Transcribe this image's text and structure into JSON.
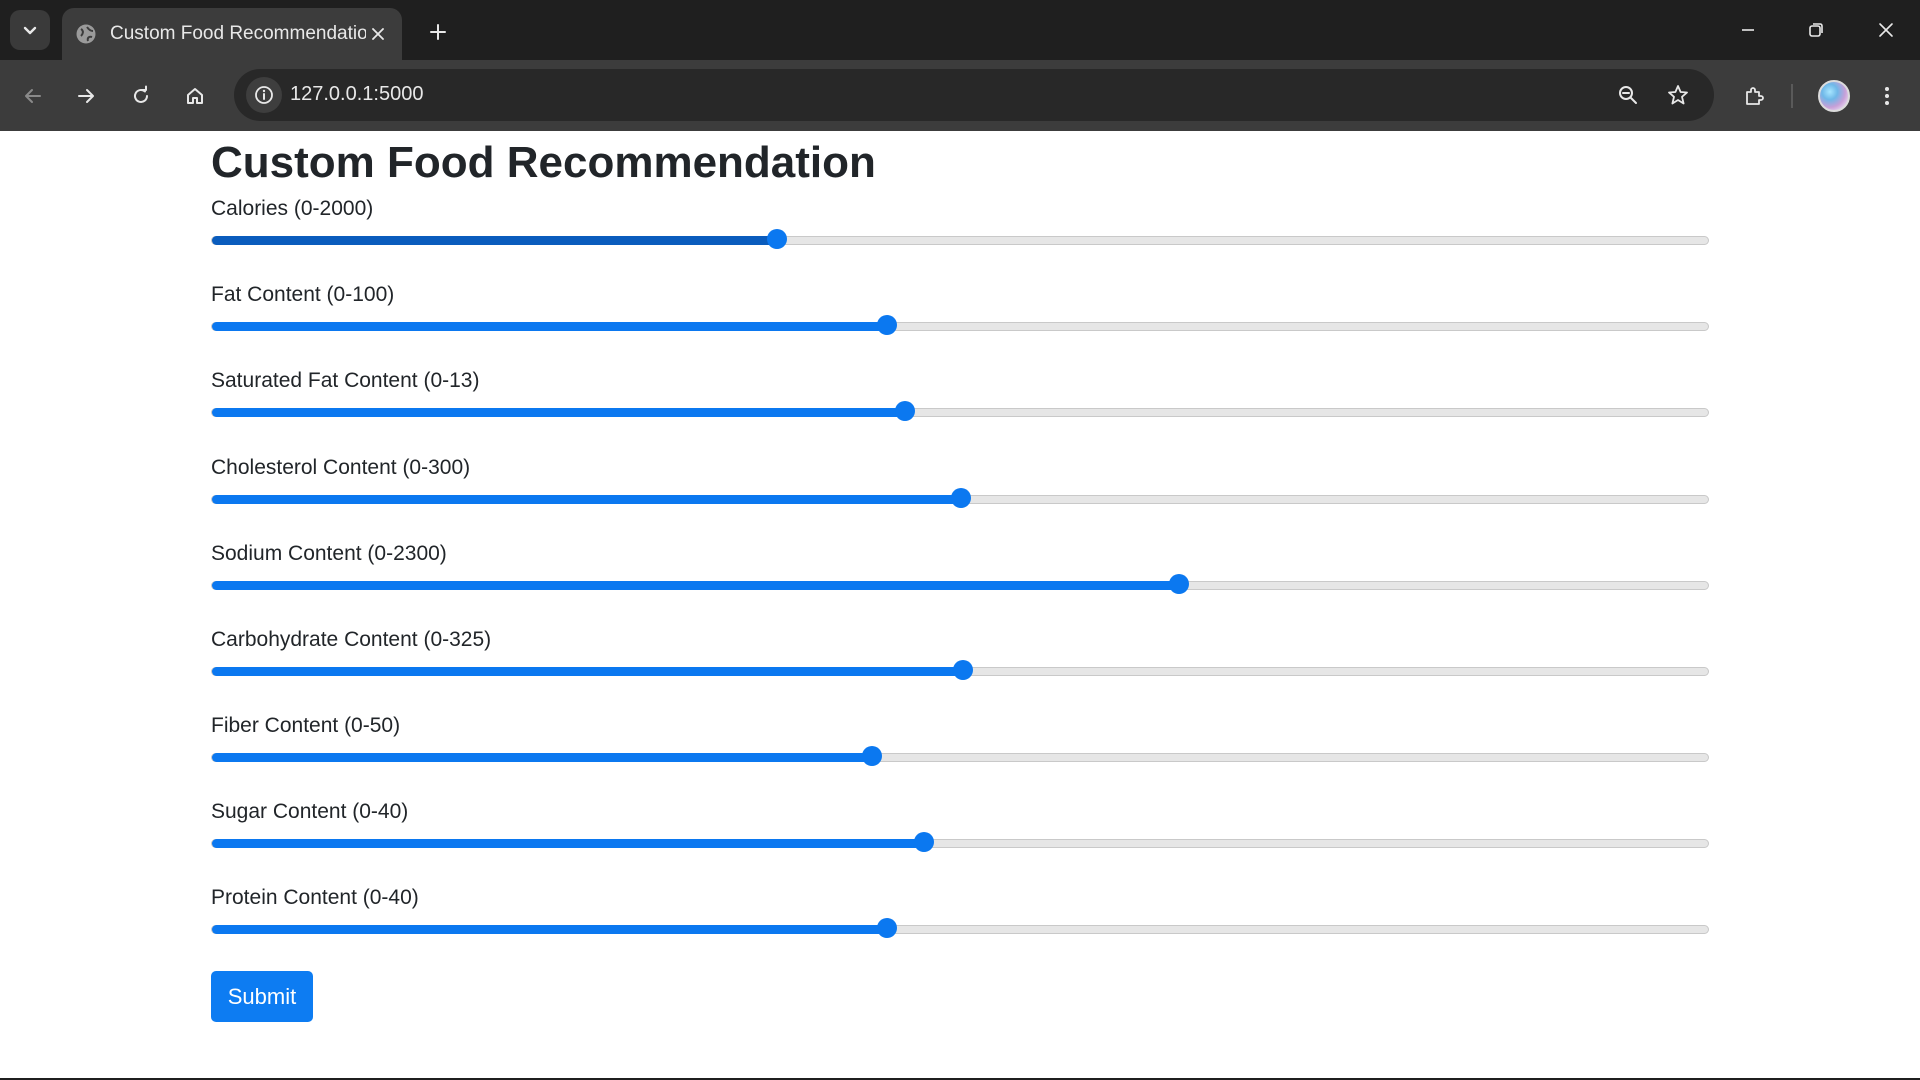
{
  "browser": {
    "tab_title": "Custom Food Recommendation",
    "url": "127.0.0.1:5000"
  },
  "page": {
    "title": "Custom Food Recommendation",
    "submit_label": "Submit"
  },
  "sliders": [
    {
      "label": "Calories (0-2000)",
      "value_fraction": 0.378,
      "focused": true
    },
    {
      "label": "Fat Content (0-100)",
      "value_fraction": 0.451
    },
    {
      "label": "Saturated Fat Content (0-13)",
      "value_fraction": 0.463
    },
    {
      "label": "Cholesterol Content (0-300)",
      "value_fraction": 0.501
    },
    {
      "label": "Sodium Content (0-2300)",
      "value_fraction": 0.646
    },
    {
      "label": "Carbohydrate Content (0-325)",
      "value_fraction": 0.502
    },
    {
      "label": "Fiber Content (0-50)",
      "value_fraction": 0.441
    },
    {
      "label": "Sugar Content (0-40)",
      "value_fraction": 0.476
    },
    {
      "label": "Protein Content (0-40)",
      "value_fraction": 0.451
    }
  ],
  "colors": {
    "accent": "#0b78f0",
    "accent_focused": "#0a5cbd",
    "track": "#e6e6e6"
  },
  "icons": [
    "tab-search-icon",
    "globe-icon",
    "close-icon",
    "plus-icon",
    "minimize-icon",
    "restore-icon",
    "window-close-icon",
    "back-icon",
    "forward-icon",
    "reload-icon",
    "home-icon",
    "info-icon",
    "zoom-icon",
    "star-icon",
    "extensions-icon",
    "profile-avatar",
    "menu-dots-icon"
  ]
}
